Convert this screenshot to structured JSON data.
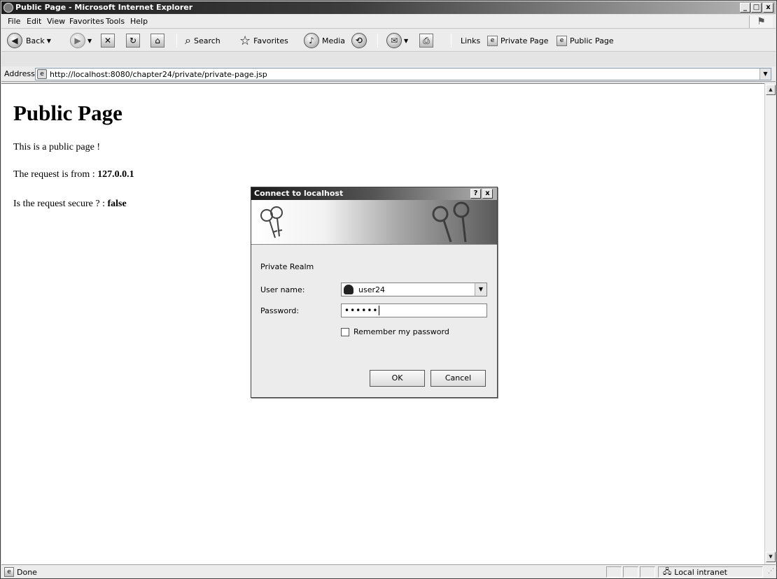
{
  "window": {
    "title": "Public Page - Microsoft Internet Explorer",
    "min": "_",
    "max": "□",
    "close": "x"
  },
  "menu": [
    "File",
    "Edit",
    "View",
    "Favorites",
    "Tools",
    "Help"
  ],
  "toolbar": {
    "back": "Back",
    "search": "Search",
    "favorites": "Favorites",
    "media": "Media",
    "links": "Links",
    "link1": "Private Page",
    "link2": "Public Page"
  },
  "address": {
    "label": "Address",
    "url": "http://localhost:8080/chapter24/private/private-page.jsp"
  },
  "page": {
    "heading": "Public Page",
    "line1": "This is a public page !",
    "line2_prefix": "The request is from : ",
    "line2_value": "127.0.0.1",
    "line3_prefix": "Is the request secure ? : ",
    "line3_value": "false"
  },
  "dialog": {
    "title": "Connect to localhost",
    "help": "?",
    "close": "x",
    "realm": "Private Realm",
    "user_label": "User name:",
    "user_value": "user24",
    "password_label": "Password:",
    "password_value": "••••••",
    "remember_label": "Remember my password",
    "ok": "OK",
    "cancel": "Cancel"
  },
  "status": {
    "text": "Done",
    "zone": "Local intranet"
  }
}
